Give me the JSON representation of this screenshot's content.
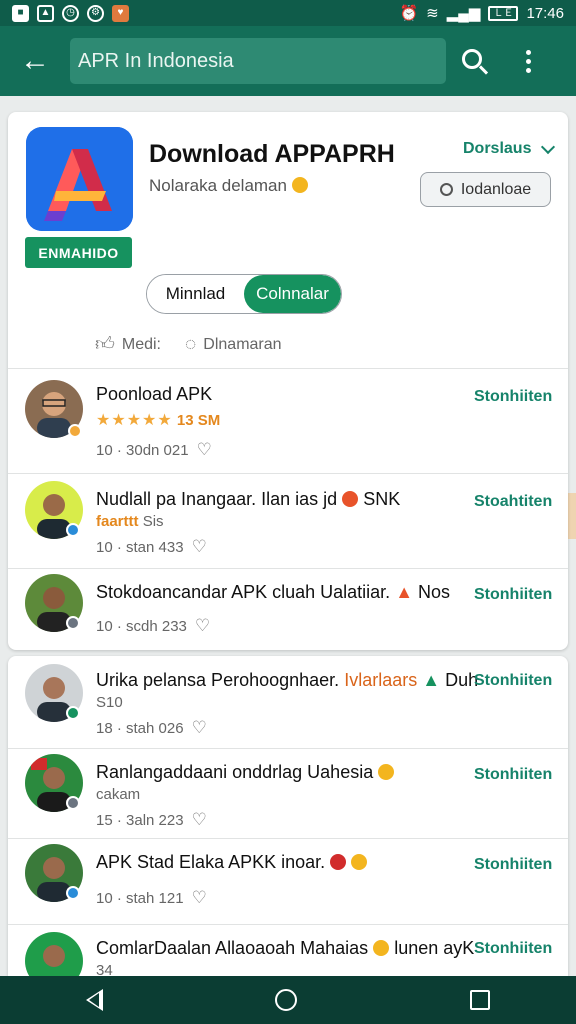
{
  "status_bar": {
    "time": "17:46",
    "battery_label": "ＬＥ",
    "signal": "▂▄▆"
  },
  "app_bar": {
    "search_text": "APR In Indonesia"
  },
  "header": {
    "title": "Download APPAPRH",
    "subtitle": "Nolaraka delaman",
    "badge": "ENMAHIDO",
    "downloads_label": "Dorslaus",
    "outline_button": "Iodanloae",
    "seg_left": "Minnlad",
    "seg_right": "Colnnalar",
    "reaction_1": "Medi:",
    "reaction_2": "Dlnamaran"
  },
  "colors": {
    "primary": "#136e58",
    "accent_green": "#16925f",
    "link_green": "#16836a",
    "star": "#f2a93b"
  },
  "rows": [
    {
      "title": "Poonload APK",
      "stars": "★★★★★",
      "sub_extra": "13 SM",
      "meta": "10 · 30dn 021",
      "action": "Stonhiiten"
    },
    {
      "title": "Nudlall pa Inangaar. Ilan ias jd",
      "title_tail": "SNK",
      "sub_orange": "faarttt",
      "sub_extra": "Sis",
      "meta": "10 · stan 433",
      "action": "Stoahtiten"
    },
    {
      "title": "Stokdoancandar APK cluah Ualatiiar.",
      "title_tail": "Nos",
      "meta": "10 · scdh 233",
      "action": "Stonhiiten"
    },
    {
      "title": "Urika pelansa Perohoognhaer.",
      "title_orange": "Ivlarlaars",
      "title_tail": "Duh",
      "sub_extra": "S10",
      "meta": "18 · stah 026",
      "action": "Stonhiiten"
    },
    {
      "title": "Ranlangaddaani onddrlag Uahesia",
      "sub_extra": "cakam",
      "meta": "15 · 3aln 223",
      "action": "Stonhiiten"
    },
    {
      "title": "APK Stad Elaka APKK inoar.",
      "meta": "10 · stah 121",
      "action": "Stonhiiten"
    },
    {
      "title": "ComlarDaalan Allaoaoah Mahaias",
      "title_tail": "lunen ayK",
      "sub_extra": "34",
      "action": "Stonhiiten"
    }
  ]
}
